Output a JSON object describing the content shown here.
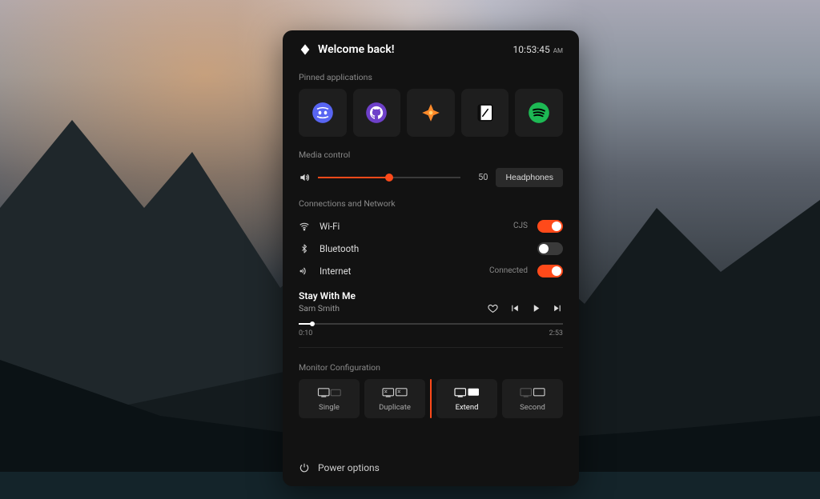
{
  "header": {
    "title": "Welcome back!",
    "time": "10:53:45",
    "ampm": "AM"
  },
  "pinned": {
    "label": "Pinned applications",
    "apps": [
      {
        "name": "discord",
        "color": "#5865F2"
      },
      {
        "name": "github",
        "color": "#9b59b6"
      },
      {
        "name": "compass",
        "color": "#ff6a1a"
      },
      {
        "name": "notes",
        "color": "#ffffff"
      },
      {
        "name": "spotify",
        "color": "#1DB954"
      }
    ]
  },
  "media": {
    "label": "Media control",
    "volume": 50,
    "volume_pct": 50,
    "output_label": "Headphones"
  },
  "connections": {
    "label": "Connections and Network",
    "items": [
      {
        "id": "wifi",
        "label": "Wi-Fi",
        "status": "CJS",
        "on": true
      },
      {
        "id": "bluetooth",
        "label": "Bluetooth",
        "status": "",
        "on": false
      },
      {
        "id": "internet",
        "label": "Internet",
        "status": "Connected",
        "on": true
      }
    ]
  },
  "player": {
    "title": "Stay With Me",
    "artist": "Sam Smith",
    "elapsed": "0:10",
    "total": "2:53",
    "progress_pct": 5
  },
  "monitor": {
    "label": "Monitor Configuration",
    "options": [
      "Single",
      "Duplicate",
      "Extend",
      "Second"
    ],
    "active": "Extend"
  },
  "footer": {
    "power": "Power options"
  },
  "colors": {
    "accent": "#ff4a1a"
  }
}
